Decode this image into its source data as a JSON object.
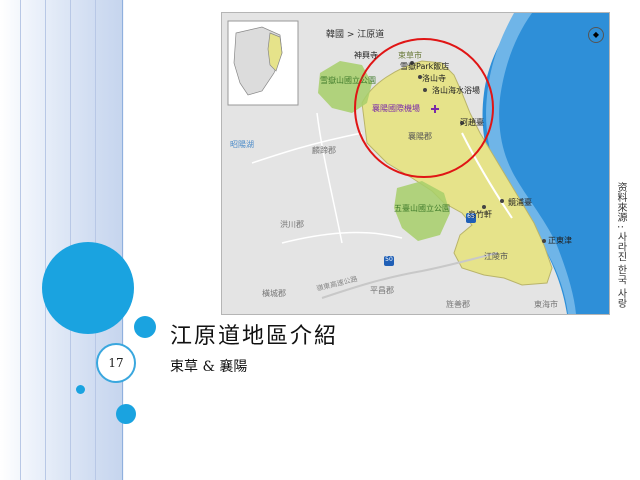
{
  "slide": {
    "number": "17",
    "title": "江原道地區介紹",
    "subtitle": "束草 & 襄陽",
    "side_caption": "资料來源 : 사라진 한국 사랑"
  },
  "map": {
    "header": "韓國 > 江原道",
    "inset_icon": "map-pin-icon",
    "parks": [
      "雪嶽山國立公園",
      "五臺山國立公園"
    ],
    "places": {
      "sinheungsa": "神興寺",
      "sokcho": "束草市",
      "seorak_park_hotel": "雪嶽Park飯店",
      "naksansa": "洛山寺",
      "naksan_beach": "洛山海水浴場",
      "yangyang_airport": "襄陽國際機場",
      "yangyang": "襄陽郡",
      "hajodae": "河趙臺",
      "gyeongpodae": "鏡浦臺",
      "ojukheon": "烏竹軒",
      "gangneung": "江陵市",
      "jeongdongjin": "正東津",
      "inje": "麟蹄郡",
      "hongcheon": "洪川郡",
      "hoengseong": "橫城郡",
      "pyeongchang": "平昌郡",
      "jeongseon": "旌善郡",
      "donghae": "東海市",
      "chuncheon_lake": "昭陽湖",
      "highway": "嶺東高速公路",
      "route_num_1": "65",
      "route_num_2": "50"
    }
  }
}
